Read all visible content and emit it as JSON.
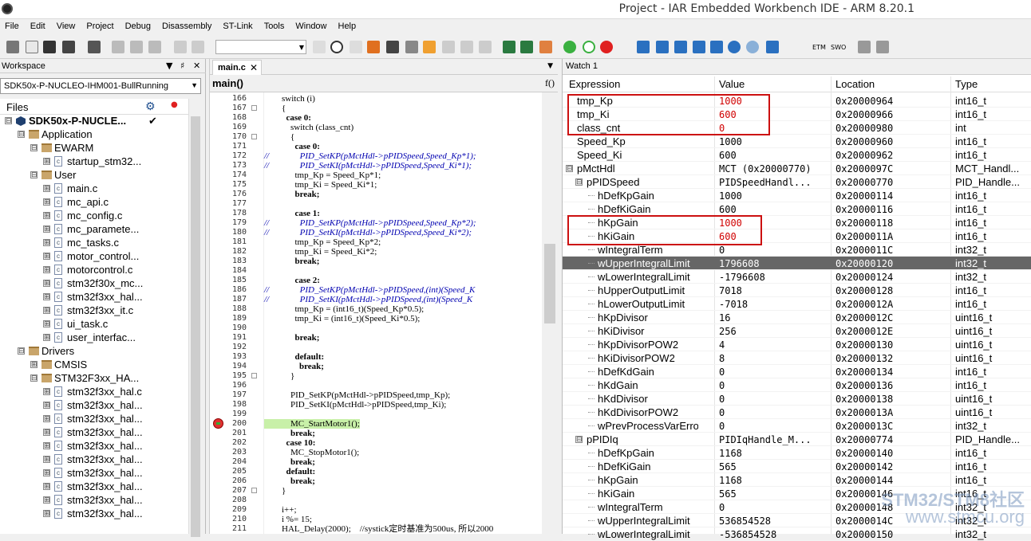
{
  "window": {
    "title": "Project - IAR Embedded Workbench IDE - ARM 8.20.1"
  },
  "menu": [
    "File",
    "Edit",
    "View",
    "Project",
    "Debug",
    "Disassembly",
    "ST-Link",
    "Tools",
    "Window",
    "Help"
  ],
  "toolbar": {
    "etm_label": "ETM",
    "swo_label": "SWO"
  },
  "workspace": {
    "title": "Workspace",
    "config": "SDK50x-P-NUCLEO-IHM001-BullRunning",
    "files_label": "Files",
    "tree": [
      {
        "label": "SDK50x-P-NUCLE...",
        "indent": 0,
        "kind": "project",
        "tg": "⊟"
      },
      {
        "label": "Application",
        "indent": 1,
        "kind": "folder",
        "tg": "⊟"
      },
      {
        "label": "EWARM",
        "indent": 2,
        "kind": "folder",
        "tg": "⊟"
      },
      {
        "label": "startup_stm32...",
        "indent": 3,
        "kind": "file",
        "tg": "⊞"
      },
      {
        "label": "User",
        "indent": 2,
        "kind": "folder",
        "tg": "⊟"
      },
      {
        "label": "main.c",
        "indent": 3,
        "kind": "file",
        "tg": "⊞"
      },
      {
        "label": "mc_api.c",
        "indent": 3,
        "kind": "file",
        "tg": "⊞"
      },
      {
        "label": "mc_config.c",
        "indent": 3,
        "kind": "file",
        "tg": "⊞"
      },
      {
        "label": "mc_paramete...",
        "indent": 3,
        "kind": "file",
        "tg": "⊞"
      },
      {
        "label": "mc_tasks.c",
        "indent": 3,
        "kind": "file",
        "tg": "⊞"
      },
      {
        "label": "motor_control...",
        "indent": 3,
        "kind": "file",
        "tg": "⊞"
      },
      {
        "label": "motorcontrol.c",
        "indent": 3,
        "kind": "file",
        "tg": "⊞"
      },
      {
        "label": "stm32f30x_mc...",
        "indent": 3,
        "kind": "file",
        "tg": "⊞"
      },
      {
        "label": "stm32f3xx_hal...",
        "indent": 3,
        "kind": "file",
        "tg": "⊞"
      },
      {
        "label": "stm32f3xx_it.c",
        "indent": 3,
        "kind": "file",
        "tg": "⊞"
      },
      {
        "label": "ui_task.c",
        "indent": 3,
        "kind": "file",
        "tg": "⊞"
      },
      {
        "label": "user_interfac...",
        "indent": 3,
        "kind": "file",
        "tg": "⊞"
      },
      {
        "label": "Drivers",
        "indent": 1,
        "kind": "folder",
        "tg": "⊟"
      },
      {
        "label": "CMSIS",
        "indent": 2,
        "kind": "folder",
        "tg": "⊞"
      },
      {
        "label": "STM32F3xx_HA...",
        "indent": 2,
        "kind": "folder",
        "tg": "⊟"
      },
      {
        "label": "stm32f3xx_hal.c",
        "indent": 3,
        "kind": "file",
        "tg": "⊞"
      },
      {
        "label": "stm32f3xx_hal...",
        "indent": 3,
        "kind": "file",
        "tg": "⊞"
      },
      {
        "label": "stm32f3xx_hal...",
        "indent": 3,
        "kind": "file",
        "tg": "⊞"
      },
      {
        "label": "stm32f3xx_hal...",
        "indent": 3,
        "kind": "file",
        "tg": "⊞"
      },
      {
        "label": "stm32f3xx_hal...",
        "indent": 3,
        "kind": "file",
        "tg": "⊞"
      },
      {
        "label": "stm32f3xx_hal...",
        "indent": 3,
        "kind": "file",
        "tg": "⊞"
      },
      {
        "label": "stm32f3xx_hal...",
        "indent": 3,
        "kind": "file",
        "tg": "⊞"
      },
      {
        "label": "stm32f3xx_hal...",
        "indent": 3,
        "kind": "file",
        "tg": "⊞"
      },
      {
        "label": "stm32f3xx_hal...",
        "indent": 3,
        "kind": "file",
        "tg": "⊞"
      },
      {
        "label": "stm32f3xx_hal...",
        "indent": 3,
        "kind": "file",
        "tg": "⊞"
      }
    ]
  },
  "editor": {
    "tab": "main.c",
    "function": "main()",
    "fx": "f()",
    "lines": [
      {
        "n": "166",
        "t": "        switch (i)",
        "c": ""
      },
      {
        "n": "167",
        "t": "        {",
        "c": ""
      },
      {
        "n": "168",
        "t": "          case 0:",
        "c": "kw"
      },
      {
        "n": "169",
        "t": "            switch (class_cnt)",
        "c": ""
      },
      {
        "n": "170",
        "t": "            {",
        "c": ""
      },
      {
        "n": "171",
        "t": "              case 0:",
        "c": "kw"
      },
      {
        "n": "172",
        "t": "//              PID_SetKP(pMctHdl->pPIDSpeed,Speed_Kp*1);",
        "c": "cm"
      },
      {
        "n": "173",
        "t": "//              PID_SetKI(pMctHdl->pPIDSpeed,Speed_Ki*1);",
        "c": "cm"
      },
      {
        "n": "174",
        "t": "              tmp_Kp = Speed_Kp*1;",
        "c": ""
      },
      {
        "n": "175",
        "t": "              tmp_Ki = Speed_Ki*1;",
        "c": ""
      },
      {
        "n": "176",
        "t": "              break;",
        "c": "kw"
      },
      {
        "n": "177",
        "t": "",
        "c": ""
      },
      {
        "n": "178",
        "t": "              case 1:",
        "c": "kw"
      },
      {
        "n": "179",
        "t": "//              PID_SetKP(pMctHdl->pPIDSpeed,Speed_Kp*2);",
        "c": "cm"
      },
      {
        "n": "180",
        "t": "//              PID_SetKI(pMctHdl->pPIDSpeed,Speed_Ki*2);",
        "c": "cm"
      },
      {
        "n": "181",
        "t": "              tmp_Kp = Speed_Kp*2;",
        "c": ""
      },
      {
        "n": "182",
        "t": "              tmp_Ki = Speed_Ki*2;",
        "c": ""
      },
      {
        "n": "183",
        "t": "              break;",
        "c": "kw"
      },
      {
        "n": "184",
        "t": "",
        "c": ""
      },
      {
        "n": "185",
        "t": "              case 2:",
        "c": "kw"
      },
      {
        "n": "186",
        "t": "//              PID_SetKP(pMctHdl->pPIDSpeed,(int)(Speed_K",
        "c": "cm"
      },
      {
        "n": "187",
        "t": "//              PID_SetKI(pMctHdl->pPIDSpeed,(int)(Speed_K",
        "c": "cm"
      },
      {
        "n": "188",
        "t": "              tmp_Kp = (int16_t)(Speed_Kp*0.5);",
        "c": ""
      },
      {
        "n": "189",
        "t": "              tmp_Ki = (int16_t)(Speed_Ki*0.5);",
        "c": ""
      },
      {
        "n": "190",
        "t": "",
        "c": ""
      },
      {
        "n": "191",
        "t": "              break;",
        "c": "kw"
      },
      {
        "n": "192",
        "t": "",
        "c": ""
      },
      {
        "n": "193",
        "t": "              default:",
        "c": "kw"
      },
      {
        "n": "194",
        "t": "                break;",
        "c": "kw"
      },
      {
        "n": "195",
        "t": "            }",
        "c": ""
      },
      {
        "n": "196",
        "t": "",
        "c": ""
      },
      {
        "n": "197",
        "t": "            PID_SetKP(pMctHdl->pPIDSpeed,tmp_Kp);",
        "c": ""
      },
      {
        "n": "198",
        "t": "            PID_SetKI(pMctHdl->pPIDSpeed,tmp_Ki);",
        "c": ""
      },
      {
        "n": "199",
        "t": "",
        "c": ""
      },
      {
        "n": "200",
        "t": "            MC_StartMotor1();",
        "c": "cur"
      },
      {
        "n": "201",
        "t": "            break;",
        "c": "kw"
      },
      {
        "n": "202",
        "t": "          case 10:",
        "c": "kw"
      },
      {
        "n": "203",
        "t": "            MC_StopMotor1();",
        "c": ""
      },
      {
        "n": "204",
        "t": "            break;",
        "c": "kw"
      },
      {
        "n": "205",
        "t": "          default:",
        "c": "kw"
      },
      {
        "n": "206",
        "t": "            break;",
        "c": "kw"
      },
      {
        "n": "207",
        "t": "        }",
        "c": ""
      },
      {
        "n": "208",
        "t": "",
        "c": ""
      },
      {
        "n": "209",
        "t": "        i++;",
        "c": ""
      },
      {
        "n": "210",
        "t": "        i %= 15;",
        "c": ""
      },
      {
        "n": "211",
        "t": "        HAL_Delay(2000);    //systick定时基准为500us, 所以2000",
        "c": "mix"
      }
    ]
  },
  "watch": {
    "title": "Watch 1",
    "columns": [
      "Expression",
      "Value",
      "Location",
      "Type"
    ],
    "rows": [
      {
        "e": "tmp_Kp",
        "v": "1000",
        "l": "0x20000964",
        "t": "int16_t",
        "d": 0,
        "red": true
      },
      {
        "e": "tmp_Ki",
        "v": "600",
        "l": "0x20000966",
        "t": "int16_t",
        "d": 0,
        "red": true
      },
      {
        "e": "class_cnt",
        "v": "0",
        "l": "0x20000980",
        "t": "int",
        "d": 0,
        "red": true
      },
      {
        "e": "Speed_Kp",
        "v": "1000",
        "l": "0x20000960",
        "t": "int16_t",
        "d": 0
      },
      {
        "e": "Speed_Ki",
        "v": "600",
        "l": "0x20000962",
        "t": "int16_t",
        "d": 0
      },
      {
        "e": "pMctHdl",
        "v": "MCT (0x20000770)",
        "l": "0x2000097C",
        "t": "MCT_Handl...",
        "d": 0,
        "tg": "⊟"
      },
      {
        "e": "pPIDSpeed",
        "v": "PIDSpeedHandl...",
        "l": "0x20000770",
        "t": "PID_Handle...",
        "d": 1,
        "tg": "⊟"
      },
      {
        "e": "hDefKpGain",
        "v": "1000",
        "l": "0x20000114",
        "t": "int16_t",
        "d": 2
      },
      {
        "e": "hDefKiGain",
        "v": "600",
        "l": "0x20000116",
        "t": "int16_t",
        "d": 2
      },
      {
        "e": "hKpGain",
        "v": "1000",
        "l": "0x20000118",
        "t": "int16_t",
        "d": 2,
        "red": true
      },
      {
        "e": "hKiGain",
        "v": "600",
        "l": "0x2000011A",
        "t": "int16_t",
        "d": 2,
        "red": true
      },
      {
        "e": "wIntegralTerm",
        "v": "0",
        "l": "0x2000011C",
        "t": "int32_t",
        "d": 2
      },
      {
        "e": "wUpperIntegralLimit",
        "v": "1796608",
        "l": "0x20000120",
        "t": "int32_t",
        "d": 2,
        "sel": true
      },
      {
        "e": "wLowerIntegralLimit",
        "v": "-1796608",
        "l": "0x20000124",
        "t": "int32_t",
        "d": 2
      },
      {
        "e": "hUpperOutputLimit",
        "v": "7018",
        "l": "0x20000128",
        "t": "int16_t",
        "d": 2
      },
      {
        "e": "hLowerOutputLimit",
        "v": "-7018",
        "l": "0x2000012A",
        "t": "int16_t",
        "d": 2
      },
      {
        "e": "hKpDivisor",
        "v": "16",
        "l": "0x2000012C",
        "t": "uint16_t",
        "d": 2
      },
      {
        "e": "hKiDivisor",
        "v": "256",
        "l": "0x2000012E",
        "t": "uint16_t",
        "d": 2
      },
      {
        "e": "hKpDivisorPOW2",
        "v": "4",
        "l": "0x20000130",
        "t": "uint16_t",
        "d": 2
      },
      {
        "e": "hKiDivisorPOW2",
        "v": "8",
        "l": "0x20000132",
        "t": "uint16_t",
        "d": 2
      },
      {
        "e": "hDefKdGain",
        "v": "0",
        "l": "0x20000134",
        "t": "int16_t",
        "d": 2
      },
      {
        "e": "hKdGain",
        "v": "0",
        "l": "0x20000136",
        "t": "int16_t",
        "d": 2
      },
      {
        "e": "hKdDivisor",
        "v": "0",
        "l": "0x20000138",
        "t": "uint16_t",
        "d": 2
      },
      {
        "e": "hKdDivisorPOW2",
        "v": "0",
        "l": "0x2000013A",
        "t": "uint16_t",
        "d": 2
      },
      {
        "e": "wPrevProcessVarError",
        "v": "0",
        "l": "0x2000013C",
        "t": "int32_t",
        "d": 2
      },
      {
        "e": "pPIDIq",
        "v": "PIDIqHandle_M...",
        "l": "0x20000774",
        "t": "PID_Handle...",
        "d": 1,
        "tg": "⊟"
      },
      {
        "e": "hDefKpGain",
        "v": "1168",
        "l": "0x20000140",
        "t": "int16_t",
        "d": 2
      },
      {
        "e": "hDefKiGain",
        "v": "565",
        "l": "0x20000142",
        "t": "int16_t",
        "d": 2
      },
      {
        "e": "hKpGain",
        "v": "1168",
        "l": "0x20000144",
        "t": "int16_t",
        "d": 2
      },
      {
        "e": "hKiGain",
        "v": "565",
        "l": "0x20000146",
        "t": "int16_t",
        "d": 2
      },
      {
        "e": "wIntegralTerm",
        "v": "0",
        "l": "0x20000148",
        "t": "int32_t",
        "d": 2
      },
      {
        "e": "wUpperIntegralLimit",
        "v": "536854528",
        "l": "0x2000014C",
        "t": "int32_t",
        "d": 2
      },
      {
        "e": "wLowerIntegralLimit",
        "v": "-536854528",
        "l": "0x20000150",
        "t": "int32_t",
        "d": 2
      }
    ]
  },
  "watermark": {
    "line1": "STM32/STM8社区",
    "line2": "www.stmcu.org"
  }
}
